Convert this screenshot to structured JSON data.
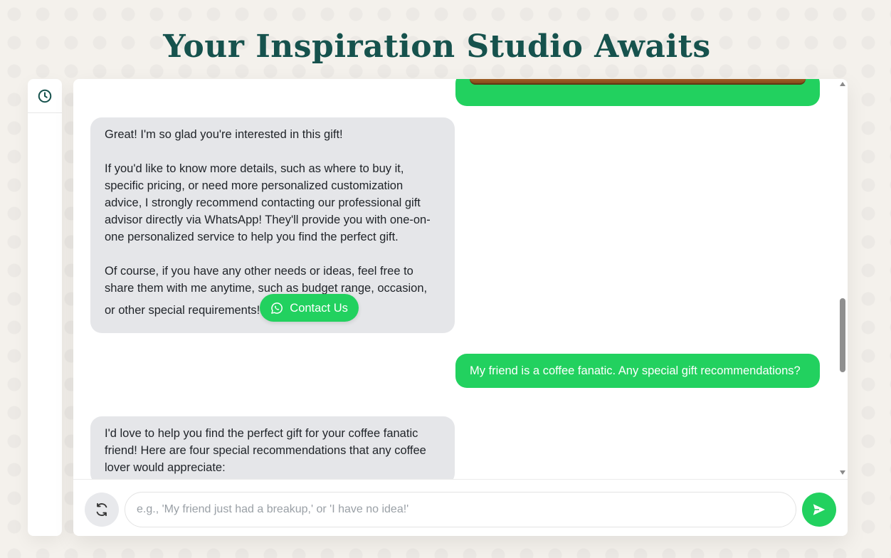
{
  "page": {
    "title": "Your Inspiration Studio Awaits"
  },
  "sidebar": {
    "history_icon": "clock-icon"
  },
  "messages": [
    {
      "role": "bot",
      "text": "Great! I'm so glad you're interested in this gift!\n\nIf you'd like to know more details, such as where to buy it, specific pricing, or need more personalized customization advice, I strongly recommend contacting our professional gift advisor directly via WhatsApp! They'll provide you with one-on-one personalized service to help you find the perfect gift.\n\nOf course, if you have any other needs or ideas, feel free to share them with me anytime, such as budget range, occasion, or other special requirements!",
      "button_label": "Contact Us",
      "button_icon": "whatsapp-icon"
    },
    {
      "role": "user",
      "text": "My friend is a coffee fanatic. Any special gift recommendations?"
    },
    {
      "role": "bot",
      "text": "I'd love to help you find the perfect gift for your coffee fanatic friend! Here are four special recommendations that any coffee lover would appreciate:"
    }
  ],
  "composer": {
    "placeholder": "e.g., 'My friend just had a breakup,' or 'I have no idea!'",
    "refresh_icon": "refresh-icon",
    "send_icon": "send-icon"
  },
  "colors": {
    "accent_green": "#22d15f",
    "title_teal": "#16524d",
    "bot_bubble": "#e5e6e9"
  }
}
